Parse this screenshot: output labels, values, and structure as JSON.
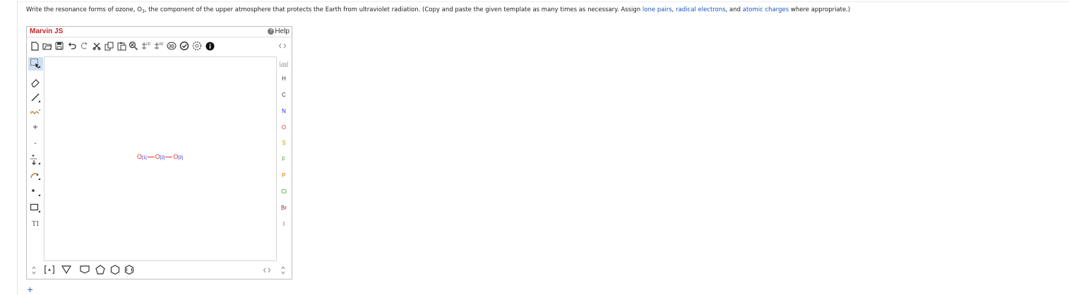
{
  "question": {
    "prefix": "Write the resonance forms of ozone, O",
    "subscript": "3",
    "middle": ", the component of the upper atmosphere that protects the Earth from ultraviolet radiation. (Copy and paste the given template as many times as necessary. Assign ",
    "link_lone_pairs": "lone pairs",
    "sep1": ", ",
    "link_radical": "radical electrons",
    "sep2": ", and ",
    "link_charges": "atomic charges",
    "suffix": " where appropriate.)"
  },
  "editor": {
    "brand": "Marvin JS",
    "help_label": "Help",
    "help_glyph": "?",
    "left_tools": {
      "plus_charge": "+",
      "minus_charge": "-",
      "text_tool": "TI"
    },
    "template_label_2d": "2D",
    "template_label_3d": "3D"
  },
  "molecule": {
    "atoms": [
      {
        "symbol": "O",
        "index": "[1]"
      },
      {
        "symbol": "O",
        "index": "[2]"
      },
      {
        "symbol": "O",
        "index": "[3]"
      }
    ]
  },
  "elements": [
    "H",
    "C",
    "N",
    "O",
    "S",
    "F",
    "P",
    "Cl",
    "Br",
    "I"
  ],
  "element_colors": {
    "H": "#333333",
    "C": "#333333",
    "N": "#2a2ad6",
    "O": "#e53030",
    "S": "#b8a000",
    "F": "#5aa02c",
    "P": "#e07000",
    "Cl": "#2a9a2a",
    "Br": "#8a2a2a",
    "I": "#555555"
  },
  "footer_plus": "+"
}
